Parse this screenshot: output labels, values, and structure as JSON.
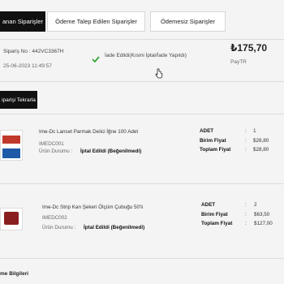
{
  "tabs": [
    {
      "label": "anan Siparişler",
      "active": true
    },
    {
      "label": "Ödeme Talep Edilen Siparişler",
      "active": false
    },
    {
      "label": "Ödemesiz Siparişler",
      "active": false
    }
  ],
  "order": {
    "number_label": "Sipariş No : 442VC3367H",
    "date": "25-06-2023 11:49:57",
    "status": "İade Edildi(Kısmi İptal/İade Yapıldı)",
    "total": "₺175,70",
    "payment_method": "PayTR",
    "reorder_label": "iparişi Tekrarla"
  },
  "items": [
    {
      "name": "Ime-Dc Lanset Parmak Delici İğne 100 Adet",
      "code": "IMEDC001",
      "status_label": "Ürün Durumu :",
      "status_value": "İptal Edildi (Beğenilmedi)",
      "qty_label": "ADET",
      "qty": "1",
      "unit_label": "Birim Fiyat",
      "unit_price": "$28,80",
      "total_label": "Toplam Fiyat",
      "total_price": "$28,80"
    },
    {
      "name": "Ime-Dc Strip Kan Şekeri Ölçüm Çubuğu 50'li",
      "code": "IMEDC002",
      "status_label": "Ürün Durumu :",
      "status_value": "İptal Edildi (Beğenilmedi)",
      "qty_label": "ADET",
      "qty": "2",
      "unit_label": "Birim Fiyat",
      "unit_price": "$63,50",
      "total_label": "Toplam Fiyat",
      "total_price": "$127,00"
    }
  ],
  "section_title": "me Bilgileri",
  "colors": {
    "accent_dark": "#111111",
    "status_green": "#3aa53a"
  }
}
